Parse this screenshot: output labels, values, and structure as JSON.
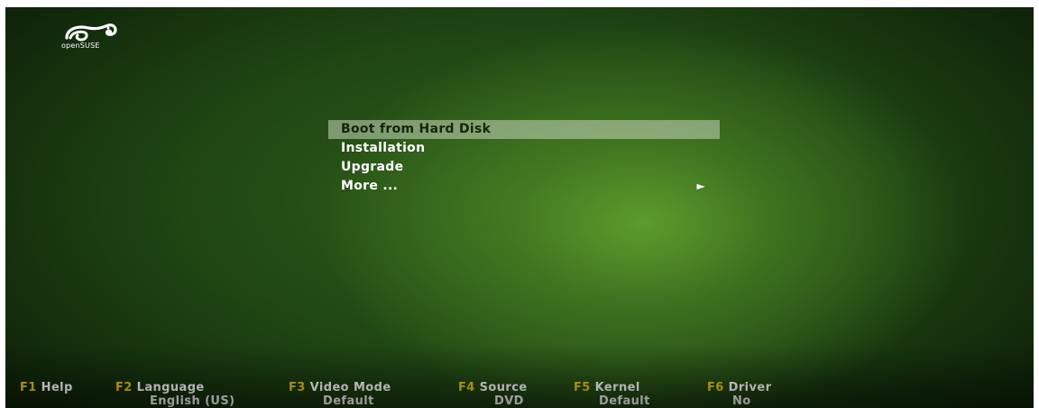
{
  "logo": {
    "text": "openSUSE"
  },
  "menu": {
    "items": [
      {
        "label": "Boot from Hard Disk",
        "selected": true
      },
      {
        "label": "Installation"
      },
      {
        "label": "Upgrade"
      },
      {
        "label": "More ...",
        "arrow": "►"
      }
    ]
  },
  "fkeys": [
    {
      "key": "F1",
      "label": "Help",
      "value": ""
    },
    {
      "key": "F2",
      "label": "Language",
      "value": "English (US)"
    },
    {
      "key": "F3",
      "label": "Video Mode",
      "value": "Default"
    },
    {
      "key": "F4",
      "label": "Source",
      "value": "DVD"
    },
    {
      "key": "F5",
      "label": "Kernel",
      "value": "Default"
    },
    {
      "key": "F6",
      "label": "Driver",
      "value": "No"
    }
  ],
  "colors": {
    "fkey_accent": "#f0c419",
    "selection_bg": "#c8d7be",
    "background_dark": "#0d1f08",
    "background_glow": "#5c9b2c"
  }
}
